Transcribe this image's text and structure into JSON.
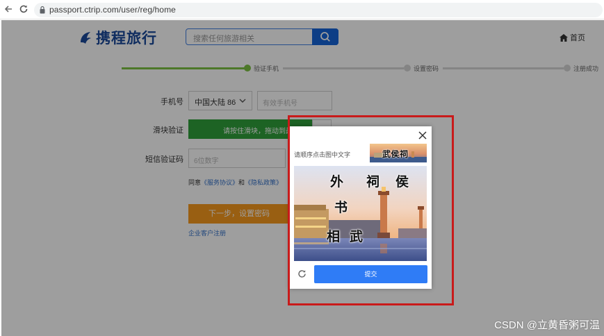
{
  "browser": {
    "url": "passport.ctrip.com/user/reg/home"
  },
  "header": {
    "logo_text": "携程旅行",
    "search_placeholder": "搜索任何旅游相关",
    "home_label": "首页"
  },
  "progress": {
    "steps": [
      "验证手机",
      "设置密码",
      "注册成功"
    ],
    "active_index": 0
  },
  "form": {
    "phone_label": "手机号",
    "country_value": "中国大陆 86",
    "phone_placeholder": "有效手机号",
    "slider_label": "滑块验证",
    "slider_text": "请按住滑块，拖动到最右边",
    "sms_label": "短信验证码",
    "sms_placeholder": "6位数字",
    "agree_prefix": "同意",
    "agree_link1": "《服务协议》",
    "agree_and": "和",
    "agree_link2": "《隐私政策》",
    "next_button": "下一步，设置密码",
    "corp_link": "企业客户注册"
  },
  "captcha": {
    "instruction": "请顺序点击图中文字",
    "target": "武侯祠",
    "chars": [
      "外",
      "祠",
      "侯",
      "书",
      "相",
      "武"
    ],
    "submit": "提交"
  },
  "watermark": "CSDN @立黄昏粥可温",
  "colors": {
    "brand_blue": "#1a4a9c",
    "search_blue": "#1565d8",
    "progress_green": "#7cc243",
    "slider_green": "#2fa13a",
    "next_orange": "#f79a1e",
    "submit_blue": "#2f7cf6",
    "highlight_red": "#c91a1a"
  }
}
